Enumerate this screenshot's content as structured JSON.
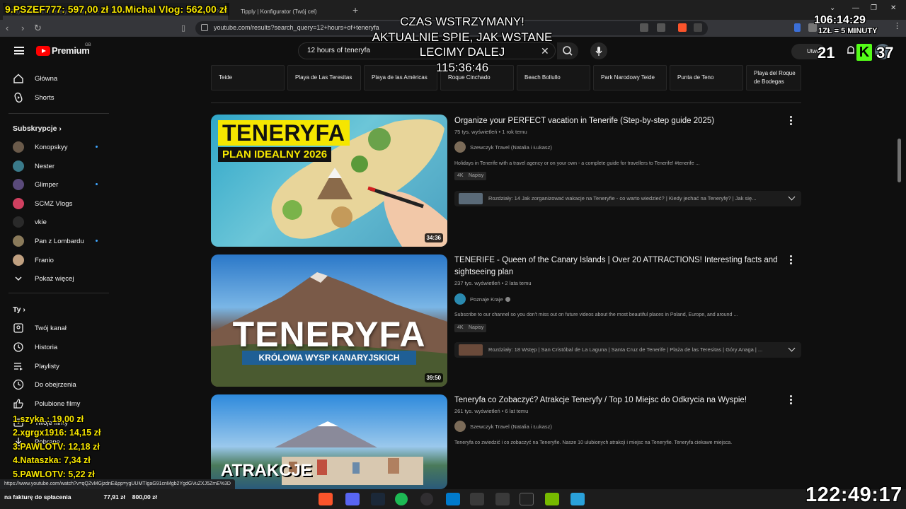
{
  "browser": {
    "tabs": [
      {
        "label": "(35) 12 hours of teneryfa - YouTube"
      },
      {
        "label": "Tipply | Konfigurator (Twój cel)"
      }
    ],
    "url": "youtube.com/results?search_query=12+hours+of+teneryfa"
  },
  "youtube": {
    "brand": "Premium",
    "region": "GB",
    "search_value": "12 hours of teneryfa",
    "create_label": "Utwórz"
  },
  "sidebar": {
    "main": [
      {
        "label": "Główna",
        "icon": "home-icon"
      },
      {
        "label": "Shorts",
        "icon": "shorts-icon"
      }
    ],
    "subs_title": "Subskrypcje",
    "subs": [
      {
        "label": "Konopskyy",
        "dot": true,
        "color": "#6a5a4a"
      },
      {
        "label": "Nester",
        "dot": false,
        "color": "#3a7a8a"
      },
      {
        "label": "Glimper",
        "dot": true,
        "color": "#5a4a7a"
      },
      {
        "label": "SCMZ Vlogs",
        "dot": false,
        "color": "#d04060"
      },
      {
        "label": "vkie",
        "dot": false,
        "color": "#2a2a2a"
      },
      {
        "label": "Pan z Lombardu",
        "dot": true,
        "color": "#8a7a5a"
      },
      {
        "label": "Franio",
        "dot": false,
        "color": "#c0a080"
      }
    ],
    "show_more": "Pokaż więcej",
    "you_title": "Ty",
    "you": [
      {
        "label": "Twój kanał",
        "icon": "channel-icon"
      },
      {
        "label": "Historia",
        "icon": "history-icon"
      },
      {
        "label": "Playlisty",
        "icon": "playlists-icon"
      },
      {
        "label": "Do obejrzenia",
        "icon": "watch-later-icon"
      },
      {
        "label": "Polubione filmy",
        "icon": "like-icon"
      },
      {
        "label": "Twoje filmy",
        "icon": "your-videos-icon"
      },
      {
        "label": "Pobrane",
        "icon": "downloads-icon"
      }
    ]
  },
  "chips": [
    "Teide",
    "Playa de Las Teresitas",
    "Playa de las Américas",
    "Roque Cinchado",
    "Beach Bollullo",
    "Park Narodowy Teide",
    "Punta de Teno",
    "Playa del Roque de Bodegas"
  ],
  "results": [
    {
      "title": "Organize your PERFECT vacation in Tenerife (Step-by-step guide 2025)",
      "meta": "75 tys. wyświetleń • 1 rok temu",
      "channel": "Szewczyk Travel (Natalia i Łukasz)",
      "description": "Holidays in Tenerife with a travel agency or on your own - a complete guide for travellers to Tenerife! #tenerife ...",
      "badges": [
        "4K",
        "Napisy"
      ],
      "chapters": "Rozdziały: 14  Jak zorganizować wakacje na Teneryfie - co warto wiedzieć? | Kiedy jechać na Teneryfę? | Jak się...",
      "duration": "34:36",
      "thumb_title": "TENERYFA",
      "thumb_subtitle": "PLAN IDEALNY 2026"
    },
    {
      "title": "TENERIFE - Queen of the Canary Islands | Over 20 ATTRACTIONS! Interesting facts and sightseeing plan",
      "meta": "237 tys. wyświetleń • 2 lata temu",
      "channel": "Poznaje Kraje",
      "description": "Subscribe to our channel so you don't miss out on future videos about the most beautiful places in Poland, Europe, and around ...",
      "badges": [
        "4K",
        "Napisy"
      ],
      "chapters": "Rozdziały: 18  Wstęp | San Cristóbal de La Laguna | Santa Cruz de Tenerife | Plaża de las Teresitas | Góry Anaga | ...",
      "duration": "39:50",
      "thumb_title": "TENERYFA",
      "thumb_subtitle": "KRÓLOWA WYSP KANARYJSKICH"
    },
    {
      "title": "Teneryfa co Zobaczyć? Atrakcje Teneryfy / Top 10 Miejsc do Odkrycia na Wyspie!",
      "meta": "261 tys. wyświetleń • 6 lat temu",
      "channel": "Szewczyk Travel (Natalia i Łukasz)",
      "description": "Teneryfa co zwiedzić i co zobaczyć na Teneryfie. Nasze 10 ulubionych atrakcji i miejsc na Teneryfie. Teneryfa ciekawe miejsca.",
      "thumb_title": "ATRAKCJE"
    }
  ],
  "overlay": {
    "donation_top": "9.PSZEF777: 597,00 zł 10.Michal Vlog: 562,00 zł",
    "center_lines": [
      "CZAS WSTRZYMANY!",
      "AKTUALNIE SPIE, JAK WSTANE",
      "LECIMY DALEJ",
      "115:36:46"
    ],
    "clock": "106:14:29",
    "rate": "1ZŁ = 5 MINUTY",
    "count_left": "21",
    "k_label": "K",
    "count_right": "37",
    "ranking": [
      "1.szyka : 19,00 zł",
      "2.xgrgx1916: 14,15 zł",
      "3.PAWLOTV: 12,18 zł",
      "4.Nataszka: 7,34 zł",
      "5.PAWLOTV: 5,22 zł"
    ],
    "timer": "122:49:17"
  },
  "status_url": "https://www.youtube.com/watch?v=qQZvMGjzdnE&pp=ygUUMTIgaG91cnMgb2YgdGVuZXJ5ZmE%3D",
  "taskbar": {
    "app_label": "na fakturę do spłacenia",
    "amount1": "77,91 zł",
    "amount2": "800,00 zł"
  }
}
